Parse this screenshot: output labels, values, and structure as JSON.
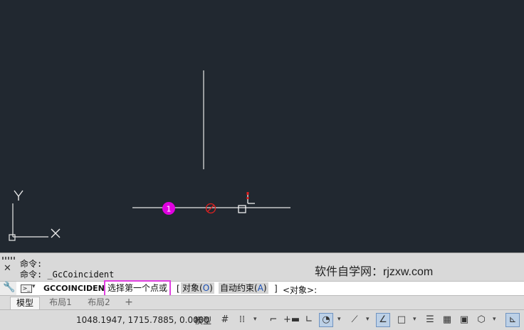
{
  "canvas": {
    "background": "#212830",
    "ucs": {
      "x_label": "X",
      "y_label": "Y"
    },
    "markers": {
      "constraint_number": "1",
      "constraint_symbol": "⊘"
    }
  },
  "command_history": {
    "lines": [
      "命令:",
      "命令: _GcCoincident"
    ],
    "watermark": "软件自学网：rjzxw.com"
  },
  "command_line": {
    "command": "GCCOINCIDENT",
    "prompt_highlight": "选择第一个点或",
    "bracket_open": "[",
    "options": [
      {
        "label": "对象(",
        "key": "O",
        "close": ")"
      },
      {
        "label": "自动约束(",
        "key": "A",
        "close": ")"
      }
    ],
    "bracket_close": "]",
    "default": "<对象>:"
  },
  "layout_tabs": {
    "tabs": [
      "模型",
      "布局1",
      "布局2"
    ],
    "add": "+"
  },
  "status_bar": {
    "coordinates": "1048.1947, 1715.7885, 0.0000",
    "model_label": "模型",
    "icons": [
      "grid-icon",
      "snap-icon",
      "infer-constraints-icon",
      "dynamic-input-icon",
      "ortho-icon",
      "polar-icon",
      "isodraft-icon",
      "object-snap-tracking-icon",
      "object-snap-icon",
      "lineweight-icon",
      "transparency-icon",
      "selection-cycling-icon",
      "3d-osnap-icon",
      "dynamic-ucs-icon"
    ]
  },
  "colors": {
    "highlight_border": "#e040e0",
    "marker_magenta": "#e000e0",
    "marker_red": "#e02020",
    "option_key": "#1a4fb4"
  }
}
